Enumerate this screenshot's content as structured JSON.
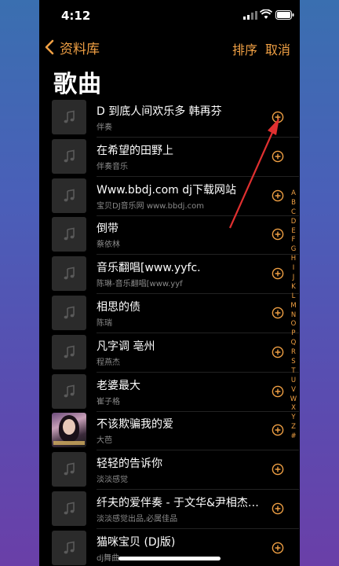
{
  "status": {
    "time": "4:12"
  },
  "nav": {
    "back_label": "资料库",
    "sort_label": "排序",
    "cancel_label": "取消"
  },
  "page": {
    "title": "歌曲"
  },
  "songs": [
    {
      "title": "D 到底人间欢乐多  韩再芬",
      "artist": "伴奏"
    },
    {
      "title": "在希望的田野上",
      "artist": "伴奏音乐"
    },
    {
      "title": "Www.bbdj.com dj下载网站",
      "artist": "宝贝DJ音乐网 www.bbdj.com"
    },
    {
      "title": "倒带",
      "artist": "蔡依林"
    },
    {
      "title": "音乐翻唱[www.yyfc.",
      "artist": "陈琳-音乐翻唱[www.yyf"
    },
    {
      "title": "相思的债",
      "artist": "陈瑞"
    },
    {
      "title": "凡字调  亳州",
      "artist": "程燕杰"
    },
    {
      "title": "老婆最大",
      "artist": "崔子格"
    },
    {
      "title": "不该欺骗我的爱",
      "artist": "大芭"
    },
    {
      "title": "轻轻的告诉你",
      "artist": "淡淡感觉"
    },
    {
      "title": "纤夫的爱伴奏 - 于文华&尹相杰…",
      "artist": "淡淡感觉出品,必属佳品"
    },
    {
      "title": "猫咪宝贝 (DJ版)",
      "artist": "dj舞曲"
    }
  ],
  "index_letters": [
    "A",
    "B",
    "C",
    "D",
    "E",
    "F",
    "G",
    "H",
    "I",
    "J",
    "K",
    "L",
    "M",
    "N",
    "O",
    "P",
    "Q",
    "R",
    "S",
    "T",
    "U",
    "V",
    "W",
    "X",
    "Y",
    "Z",
    "#"
  ],
  "colors": {
    "accent": "#f0a044",
    "annotation_arrow": "#e03030"
  },
  "icons": {
    "music_placeholder": "music-note-icon",
    "add": "add-circle-icon"
  }
}
